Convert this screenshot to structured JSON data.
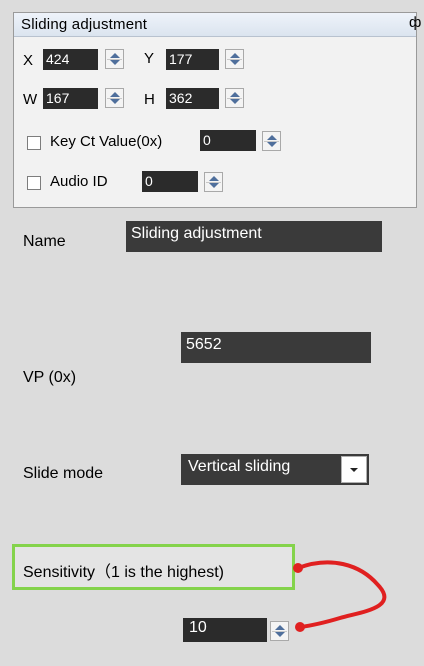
{
  "panel": {
    "title": "Sliding adjustment",
    "pin_glyph": "ф",
    "x_label": "X",
    "x_value": "424",
    "y_label": "Y",
    "y_value": "177",
    "w_label": "W",
    "w_value": "167",
    "h_label": "H",
    "h_value": "362",
    "key_label": "Key Ct Value(0x)",
    "key_value": "0",
    "audio_label": "Audio ID",
    "audio_value": "0"
  },
  "form": {
    "name_label": "Name",
    "name_value": "Sliding adjustment",
    "vp_label": "VP (0x)",
    "vp_value": "5652",
    "slide_label": "Slide mode",
    "slide_value": "Vertical sliding",
    "sens_label": "Sensitivity（1 is the highest)",
    "sens_value": "10"
  },
  "colors": {
    "highlight": "#84d34b",
    "annotation": "#e02020"
  }
}
